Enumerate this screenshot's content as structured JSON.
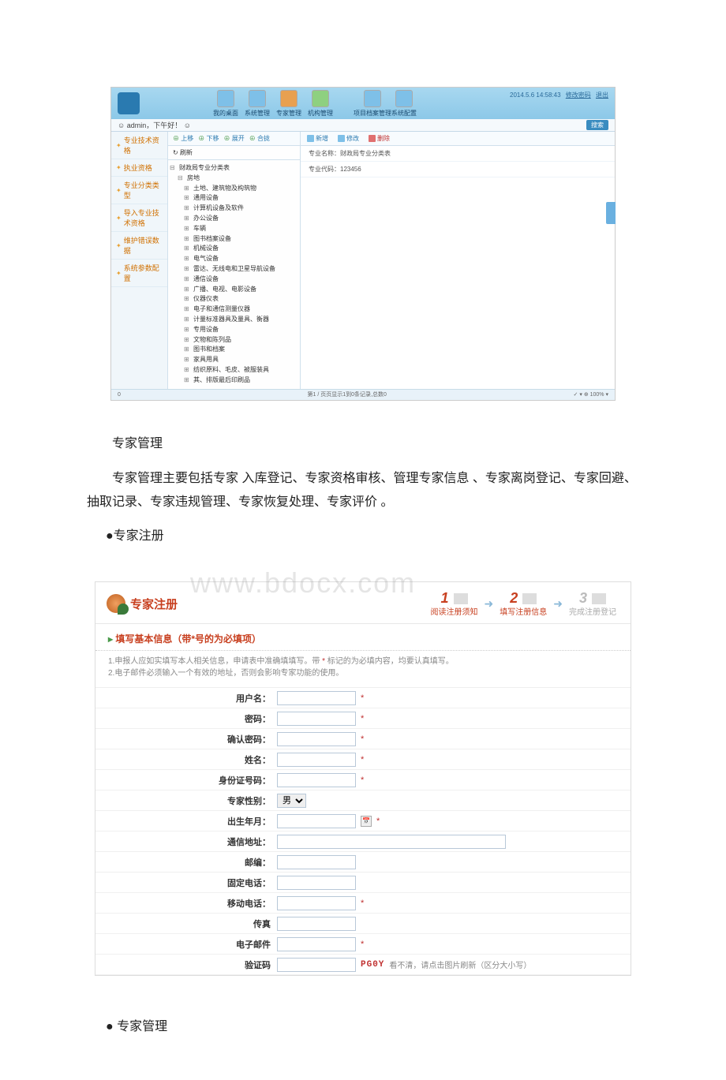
{
  "s1": {
    "timestamp": "2014.5.6 14:58:43",
    "ts_links": [
      "修改密码",
      "退出"
    ],
    "user_prefix": "admin，下午好！",
    "user_icon": "☺",
    "search_btn": "搜索",
    "toolbar_groups": [
      [
        {
          "label": "我的桌面",
          "cls": "blue"
        },
        {
          "label": "系统管理",
          "cls": "blue"
        },
        {
          "label": "专家管理",
          "cls": "orange"
        },
        {
          "label": "机构管理",
          "cls": "green"
        }
      ],
      [
        {
          "label": "项目档案管理",
          "cls": "blue"
        },
        {
          "label": "系统配置",
          "cls": "blue"
        }
      ]
    ],
    "nav": [
      "专业技术资格",
      "执业资格",
      "专业分类类型",
      "导入专业技术资格",
      "维护错误数据",
      "系统参数配置"
    ],
    "toolbar2": [
      "上移",
      "下移",
      "展开",
      "合拢"
    ],
    "refresh": "刷新",
    "tree_root": "财政局专业分类表",
    "tree_l1": "房地",
    "tree_children": [
      "土地、建筑物及构筑物",
      "通用设备",
      "计算机设备及软件",
      "办公设备",
      "车辆",
      "图书档案设备",
      "机械设备",
      "电气设备",
      "雷达、无线电和卫星导航设备",
      "通信设备",
      "广播、电视、电影设备",
      "仪器仪表",
      "电子和通信测量仪器",
      "计量标准器具及量具、衡器",
      "专用设备",
      "文物和陈列品",
      "图书和档案",
      "家具用具",
      "纺织原料、毛皮、被服装具",
      "其、排版最后印刷品"
    ],
    "rtool": [
      {
        "label": "新增",
        "cls": ""
      },
      {
        "label": "修改",
        "cls": ""
      },
      {
        "label": "删除",
        "cls": "del"
      }
    ],
    "rrows": [
      "专业名称：财政局专业分类表",
      "专业代码：123456"
    ],
    "foot_left": "0",
    "foot_mid": "第1 / 页页显示1到0条记录,总数0",
    "foot_right": "✓ ▾  ⊕ 100%  ▾"
  },
  "text": {
    "h1": "专家管理",
    "p1": "专家管理主要包括专家 入库登记、专家资格审核、管理专家信息 、专家离岗登记、专家回避、抽取记录、专家违规管理、专家恢复处理、专家评价 。",
    "b1": "●专家注册",
    "b2": "● 专家管理"
  },
  "s2": {
    "title": "专家注册",
    "steps": [
      {
        "num": "1",
        "label": "阅读注册须知"
      },
      {
        "num": "2",
        "label": "填写注册信息"
      },
      {
        "num": "3",
        "label": "完成注册登记"
      }
    ],
    "section_title": "填写基本信息（带*号的为必填项）",
    "hint1": "1.申报人应如实填写本人相关信息，申请表中准确填填写。带",
    "hint1_star": " * ",
    "hint1b": "标记的为必填内容，均要认真填写。",
    "hint2": "2.电子邮件必须输入一个有效的地址，否则会影响专家功能的使用。",
    "fields": [
      {
        "label": "用户名：",
        "type": "text",
        "req": true
      },
      {
        "label": "密码：",
        "type": "text",
        "req": true
      },
      {
        "label": "确认密码：",
        "type": "text",
        "req": true
      },
      {
        "label": "姓名：",
        "type": "text",
        "req": true
      },
      {
        "label": "身份证号码：",
        "type": "text",
        "req": true
      },
      {
        "label": "专家性别：",
        "type": "select",
        "value": "男",
        "req": false
      },
      {
        "label": "出生年月：",
        "type": "date",
        "req": true
      },
      {
        "label": "通信地址：",
        "type": "textlong",
        "req": false
      },
      {
        "label": "邮编：",
        "type": "text",
        "req": false
      },
      {
        "label": "固定电话：",
        "type": "text",
        "req": false
      },
      {
        "label": "移动电话：",
        "type": "text",
        "req": true
      },
      {
        "label": "传真",
        "type": "text",
        "req": false
      },
      {
        "label": "电子邮件",
        "type": "text",
        "req": true
      },
      {
        "label": "验证码",
        "type": "captcha",
        "req": false
      }
    ],
    "captcha_text": "PG0Y",
    "captcha_hint": "看不清，请点击图片刷新（区分大小写）"
  }
}
